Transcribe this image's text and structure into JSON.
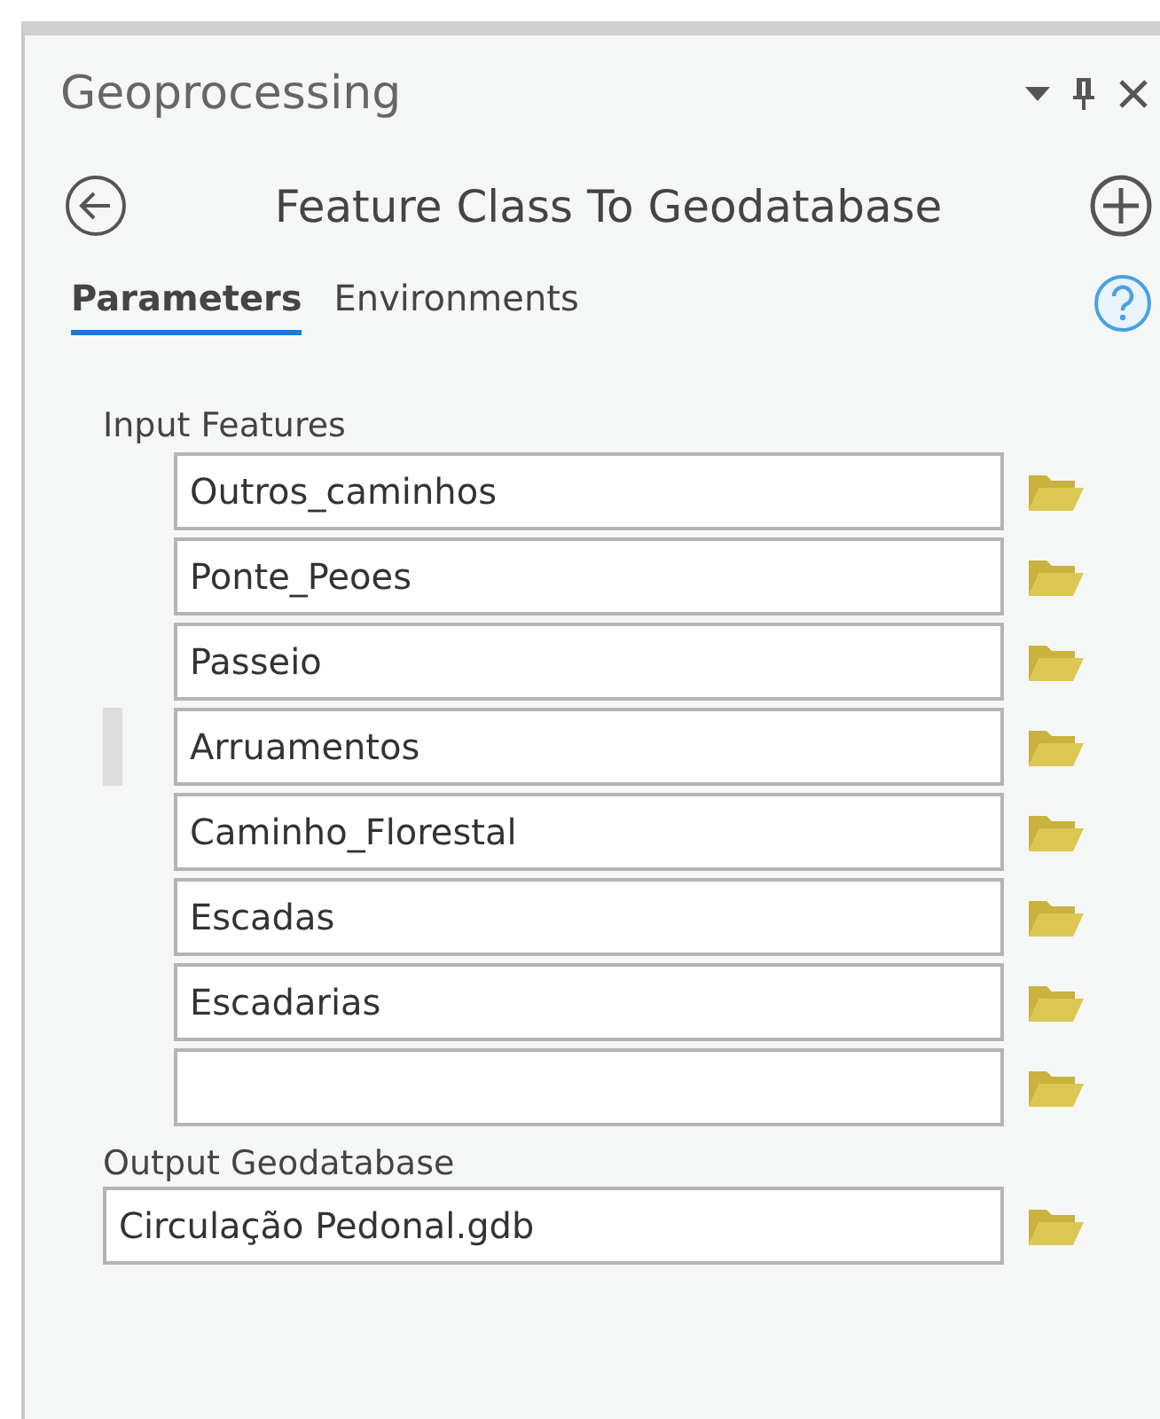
{
  "pane": {
    "title": "Geoprocessing"
  },
  "tool": {
    "title": "Feature Class To Geodatabase"
  },
  "tabs": [
    {
      "label": "Parameters",
      "selected": true
    },
    {
      "label": "Environments",
      "selected": false
    }
  ],
  "input_features": {
    "label": "Input Features",
    "rows": [
      {
        "value": "Outros_caminhos",
        "hovered": false
      },
      {
        "value": "Ponte_Peoes",
        "hovered": false
      },
      {
        "value": "Passeio",
        "hovered": false
      },
      {
        "value": "Arruamentos",
        "hovered": true
      },
      {
        "value": "Caminho_Florestal",
        "hovered": false
      },
      {
        "value": "Escadas",
        "hovered": false
      },
      {
        "value": "Escadarias",
        "hovered": false
      },
      {
        "value": "",
        "hovered": false
      }
    ]
  },
  "output_geodatabase": {
    "label": "Output Geodatabase",
    "value": "Circulação Pedonal.gdb"
  }
}
